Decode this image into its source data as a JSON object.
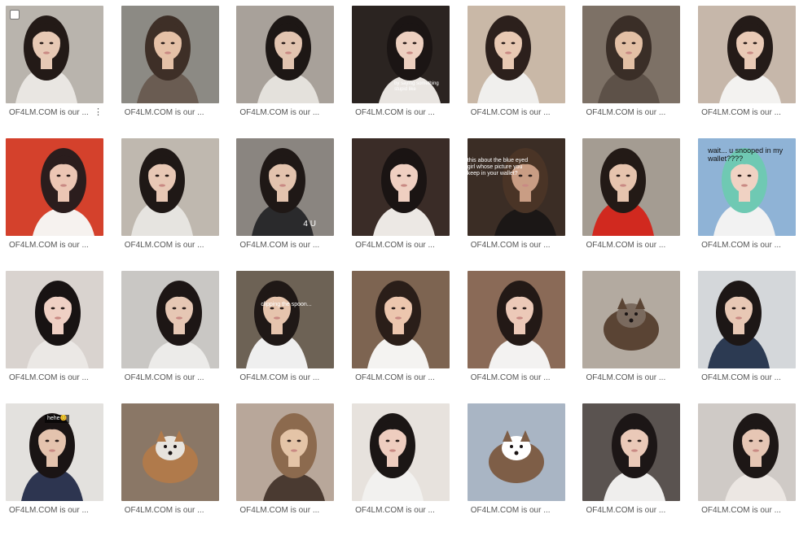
{
  "caption_text": "OF4LM.COM is our ...",
  "tiles": [
    {
      "name": "photo-1",
      "bg": "#b9b4ad",
      "skin": "#e7c9b5",
      "hair": "#231a17",
      "cloth": "#e9e6e2",
      "overlay": ""
    },
    {
      "name": "photo-2",
      "bg": "#8c8a84",
      "skin": "#e5c1a7",
      "hair": "#3e2f27",
      "cloth": "#6a5c52",
      "overlay": ""
    },
    {
      "name": "photo-3",
      "bg": "#a8a19a",
      "skin": "#e2c4b0",
      "hair": "#1d1715",
      "cloth": "#e4e1dc",
      "overlay": ""
    },
    {
      "name": "photo-4",
      "bg": "#2b2421",
      "skin": "#edd0c0",
      "hair": "#1b1514",
      "cloth": "#e9e5e1",
      "overlay": "by saying something stupid like"
    },
    {
      "name": "photo-5",
      "bg": "#c9b8a7",
      "skin": "#e8c9b3",
      "hair": "#2c201c",
      "cloth": "#f0efed",
      "overlay": ""
    },
    {
      "name": "photo-6",
      "bg": "#7d7166",
      "skin": "#e3c0a5",
      "hair": "#3a2e27",
      "cloth": "#5d5148",
      "overlay": ""
    },
    {
      "name": "photo-7",
      "bg": "#c6b7aa",
      "skin": "#e9cab6",
      "hair": "#241b18",
      "cloth": "#f3f2f0",
      "overlay": ""
    },
    {
      "name": "photo-8",
      "bg": "#d4412c",
      "skin": "#ecc6b4",
      "hair": "#2b1d1d",
      "cloth": "#f6f2ef",
      "overlay": ""
    },
    {
      "name": "photo-9",
      "bg": "#bfb8af",
      "skin": "#e8c8b5",
      "hair": "#1f1816",
      "cloth": "#e6e4e0",
      "overlay": ""
    },
    {
      "name": "photo-10",
      "bg": "#8a8580",
      "skin": "#e3c3ae",
      "hair": "#1f1816",
      "cloth": "#2a2a2c",
      "overlay": "4 U"
    },
    {
      "name": "photo-11",
      "bg": "#3a2c27",
      "skin": "#efcfc1",
      "hair": "#1a1413",
      "cloth": "#ece8e4",
      "overlay": ""
    },
    {
      "name": "photo-12",
      "bg": "#3b2d25",
      "skin": "#c99d84",
      "hair": "#4a3426",
      "cloth": "#1b1716",
      "overlay": "this about the blue eyed girl whose picture you keep in your wallet?"
    },
    {
      "name": "photo-13",
      "bg": "#a49c92",
      "skin": "#e6c4ae",
      "hair": "#231a16",
      "cloth": "#d1291f",
      "overlay": ""
    },
    {
      "name": "photo-14",
      "bg": "#8fb3d6",
      "skin": "#f0d2c3",
      "hair": "#6fc9b3",
      "cloth": "#f2f2f2",
      "overlay": "wait... u snooped in my wallet????"
    },
    {
      "name": "photo-15",
      "bg": "#d9d3cf",
      "skin": "#efd0c4",
      "hair": "#181313",
      "cloth": "#ebe8e5",
      "overlay": ""
    },
    {
      "name": "photo-16",
      "bg": "#c9c7c4",
      "skin": "#e6c7b4",
      "hair": "#1d1615",
      "cloth": "#ecebe9",
      "overlay": ""
    },
    {
      "name": "photo-17",
      "bg": "#6d6255",
      "skin": "#e6c4ad",
      "hair": "#1f1816",
      "cloth": "#efefef",
      "overlay": "clipping the spoon..."
    },
    {
      "name": "photo-18",
      "bg": "#7d6451",
      "skin": "#ecc6ae",
      "hair": "#2a1e19",
      "cloth": "#f4f3f1",
      "overlay": ""
    },
    {
      "name": "photo-19",
      "bg": "#8a6a57",
      "skin": "#ecc9b8",
      "hair": "#231916",
      "cloth": "#f3f2f1",
      "overlay": ""
    },
    {
      "name": "photo-20",
      "bg": "#b3aaa0",
      "skin": "#d9b28b",
      "hair": "#5a4434",
      "cloth": "#7a6a5e",
      "overlay": ""
    },
    {
      "name": "photo-21",
      "bg": "#d4d7da",
      "skin": "#e8c8b5",
      "hair": "#1d1716",
      "cloth": "#2c3a52",
      "overlay": ""
    },
    {
      "name": "photo-22",
      "bg": "#e3e1de",
      "skin": "#e4c3ae",
      "hair": "#1a1414",
      "cloth": "#2d3550",
      "overlay": "hehe😊"
    },
    {
      "name": "photo-23",
      "bg": "#8a7766",
      "skin": "#d6a877",
      "hair": "#b07a4b",
      "cloth": "#e7e3dd",
      "overlay": ""
    },
    {
      "name": "photo-24",
      "bg": "#b8a79a",
      "skin": "#e4c4a7",
      "hair": "#8c6a4e",
      "cloth": "#4a3a31",
      "overlay": ""
    },
    {
      "name": "photo-25",
      "bg": "#e7e2dd",
      "skin": "#eecdbf",
      "hair": "#1b1615",
      "cloth": "#f2f1ef",
      "overlay": ""
    },
    {
      "name": "photo-26",
      "bg": "#a9b5c4",
      "skin": "#ece2d9",
      "hair": "#7e5e47",
      "cloth": "#ffffff",
      "overlay": ""
    },
    {
      "name": "photo-27",
      "bg": "#5a5350",
      "skin": "#eac9b8",
      "hair": "#1c1616",
      "cloth": "#efeeed",
      "overlay": ""
    },
    {
      "name": "photo-28",
      "bg": "#cfcac6",
      "skin": "#e6c6b4",
      "hair": "#1d1716",
      "cloth": "#ece7e3",
      "overlay": ""
    }
  ]
}
